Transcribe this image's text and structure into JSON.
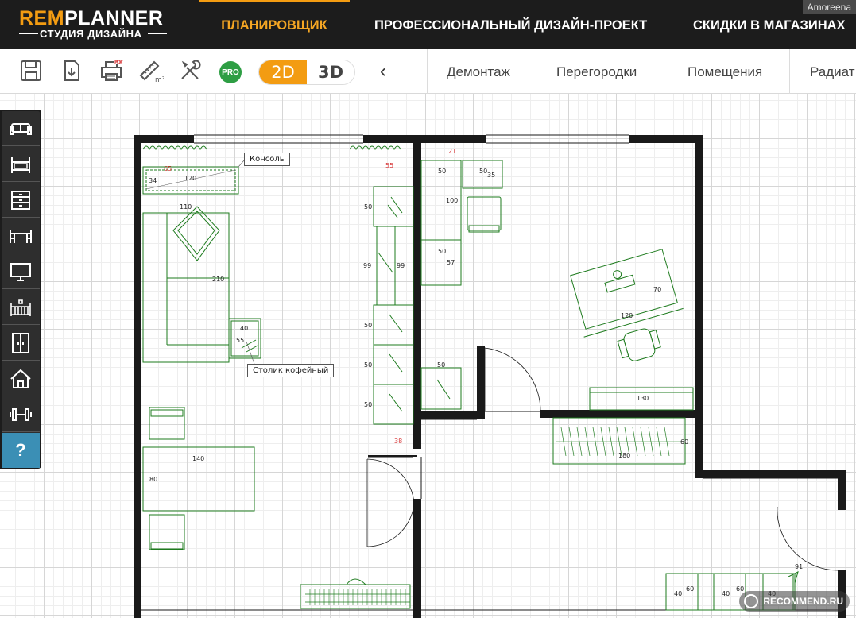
{
  "app": {
    "brand_rem": "REM",
    "brand_planner": "PLANNER",
    "brand_sub": "СТУДИЯ ДИЗАЙНА"
  },
  "topnav": {
    "planner": "ПЛАНИРОВЩИК",
    "design": "ПРОФЕССИОНАЛЬНЫЙ ДИЗАЙН-ПРОЕКТ",
    "discounts": "СКИДКИ В МАГАЗИНАХ",
    "user_watermark": "Amoreena"
  },
  "toolbar": {
    "pro_label": "PRO",
    "mode_2d": "2D",
    "mode_3d": "3D",
    "active_mode": "2D",
    "back_chevron": "‹",
    "tabs": [
      "Демонтаж",
      "Перегородки",
      "Помещения",
      "Радиат"
    ]
  },
  "sidebar": {
    "items": [
      "sofa-icon",
      "bed-icon",
      "dresser-icon",
      "table-icon",
      "tv-icon",
      "crib-icon",
      "wardrobe-icon",
      "house-icon",
      "dumbbell-icon"
    ],
    "help_label": "?"
  },
  "plan": {
    "labels": {
      "console": "Консоль",
      "coffee_table": "Столик кофейный"
    },
    "dims": {
      "console_w": "120",
      "console_d": "34",
      "console_red": "65",
      "sofa_top": "110",
      "sofa_len": "210",
      "coffee_a": "40",
      "coffee_b": "55",
      "table_w": "140",
      "table_d": "80",
      "wall_55": "55",
      "wall_38": "38",
      "wall_21": "21",
      "cab1": "50",
      "cab2a": "99",
      "cab2b": "99",
      "cab3": "50",
      "cab4": "50",
      "cab5": "50",
      "desk_top": "50",
      "desk_side": "35",
      "desk_len": "100",
      "desk_low": "50",
      "desk_low_h": "57",
      "work_w": "120",
      "work_d": "70",
      "dresser_w": "130",
      "small_cab": "50",
      "wardrobe_w": "180",
      "wardrobe_d": "60",
      "hall_91": "91",
      "hall_40a": "40",
      "hall_60a": "60",
      "hall_40b": "40",
      "hall_60b": "60",
      "hall_40c": "40"
    }
  },
  "watermark": "RECOMMEND.RU",
  "colors": {
    "accent": "#f39c12",
    "furniture": "#1e7b1e",
    "wall": "#1a1a1a",
    "help": "#3b8fb5"
  }
}
